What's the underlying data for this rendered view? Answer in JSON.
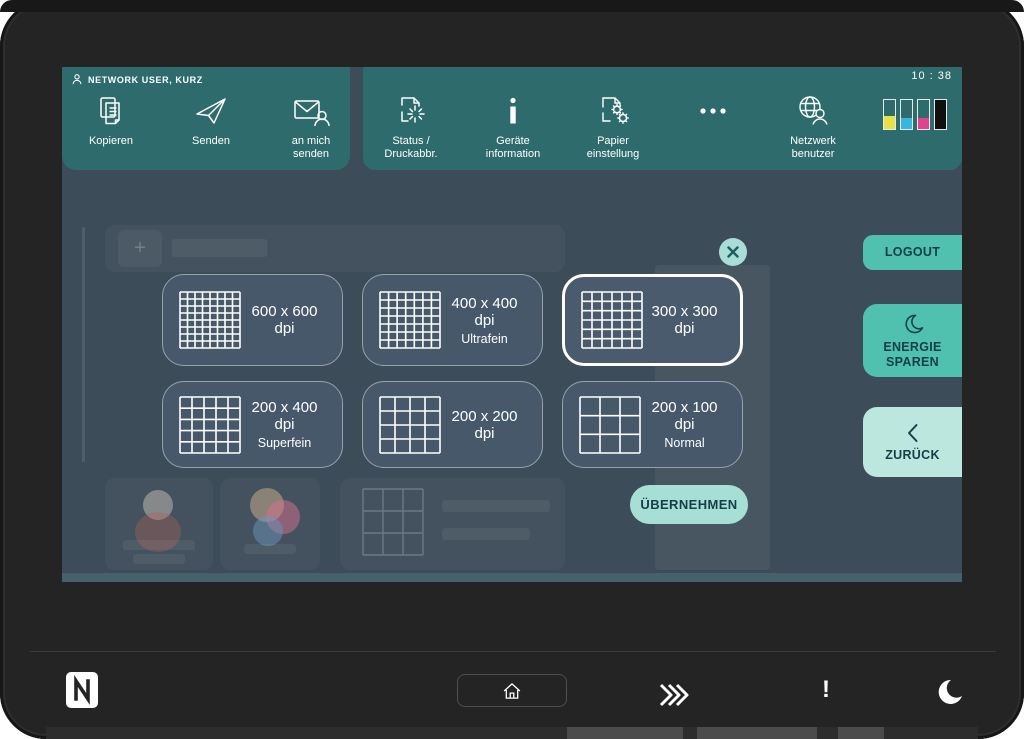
{
  "status_bar": {
    "user_label": "NETWORK USER, KURZ",
    "time": "10 : 38"
  },
  "nav": {
    "items": [
      {
        "id": "kopieren",
        "label": "Kopieren",
        "icon": "copy-pages-icon"
      },
      {
        "id": "senden",
        "label": "Senden",
        "icon": "paper-plane-icon"
      },
      {
        "id": "an-mich-senden",
        "label": "an mich\nsenden",
        "icon": "envelope-person-icon"
      },
      {
        "id": "status-druckabbr",
        "label": "Status /\nDruckabbr.",
        "icon": "page-burst-icon"
      },
      {
        "id": "geraete-information",
        "label": "Geräte\ninformation",
        "icon": "info-icon"
      },
      {
        "id": "papier-einstellung",
        "label": "Papier\neinstellung",
        "icon": "page-gears-icon"
      },
      {
        "id": "mehr",
        "label": "",
        "icon": "ellipsis-icon"
      },
      {
        "id": "netzwerk-benutzer",
        "label": "Netzwerk\nbenutzer",
        "icon": "globe-person-icon"
      }
    ]
  },
  "toner": {
    "levels": [
      {
        "name": "yellow",
        "color": "#e9e049",
        "percent": 45
      },
      {
        "name": "cyan",
        "color": "#38b5e1",
        "percent": 38
      },
      {
        "name": "magenta",
        "color": "#e2418d",
        "percent": 38
      },
      {
        "name": "black",
        "color": "#101010",
        "percent": 100
      }
    ]
  },
  "dialog": {
    "options": [
      {
        "label": "600 x 600 dpi",
        "sublabel": "",
        "grid": 8,
        "selected": false
      },
      {
        "label": "400 x 400 dpi",
        "sublabel": "Ultrafein",
        "grid": 7,
        "selected": false
      },
      {
        "label": "300 x 300 dpi",
        "sublabel": "",
        "grid": 6,
        "selected": true
      },
      {
        "label": "200 x 400 dpi",
        "sublabel": "Superfein",
        "grid": 5,
        "selected": false
      },
      {
        "label": "200 x 200 dpi",
        "sublabel": "",
        "grid": 4,
        "selected": false
      },
      {
        "label": "200 x 100 dpi",
        "sublabel": "Normal",
        "grid": 3,
        "selected": false
      }
    ],
    "apply_label": "ÜBERNEHMEN",
    "close_icon": "x-circle-icon"
  },
  "side_panel": {
    "logout_label": "LOGOUT",
    "energy_label": "ENERGIE\nSPAREN",
    "back_label": "ZURÜCK",
    "energy_icon": "moon-outline-icon",
    "back_icon": "chevron-left-icon"
  },
  "hardware_bar": {
    "nfc_icon": "nfc-nmark-icon",
    "home_icon": "home-icon",
    "interrupt_icon": "fast-forward-icon",
    "attention_label": "!",
    "sleep_icon": "moon-icon"
  },
  "colors": {
    "header_teal": "#2e6b6d",
    "screen_dim": "#3d4c59",
    "mint": "#a7ded6",
    "mint_strong": "#50c0af",
    "mint_light": "#bbe7df",
    "dark_text": "#15404a"
  }
}
